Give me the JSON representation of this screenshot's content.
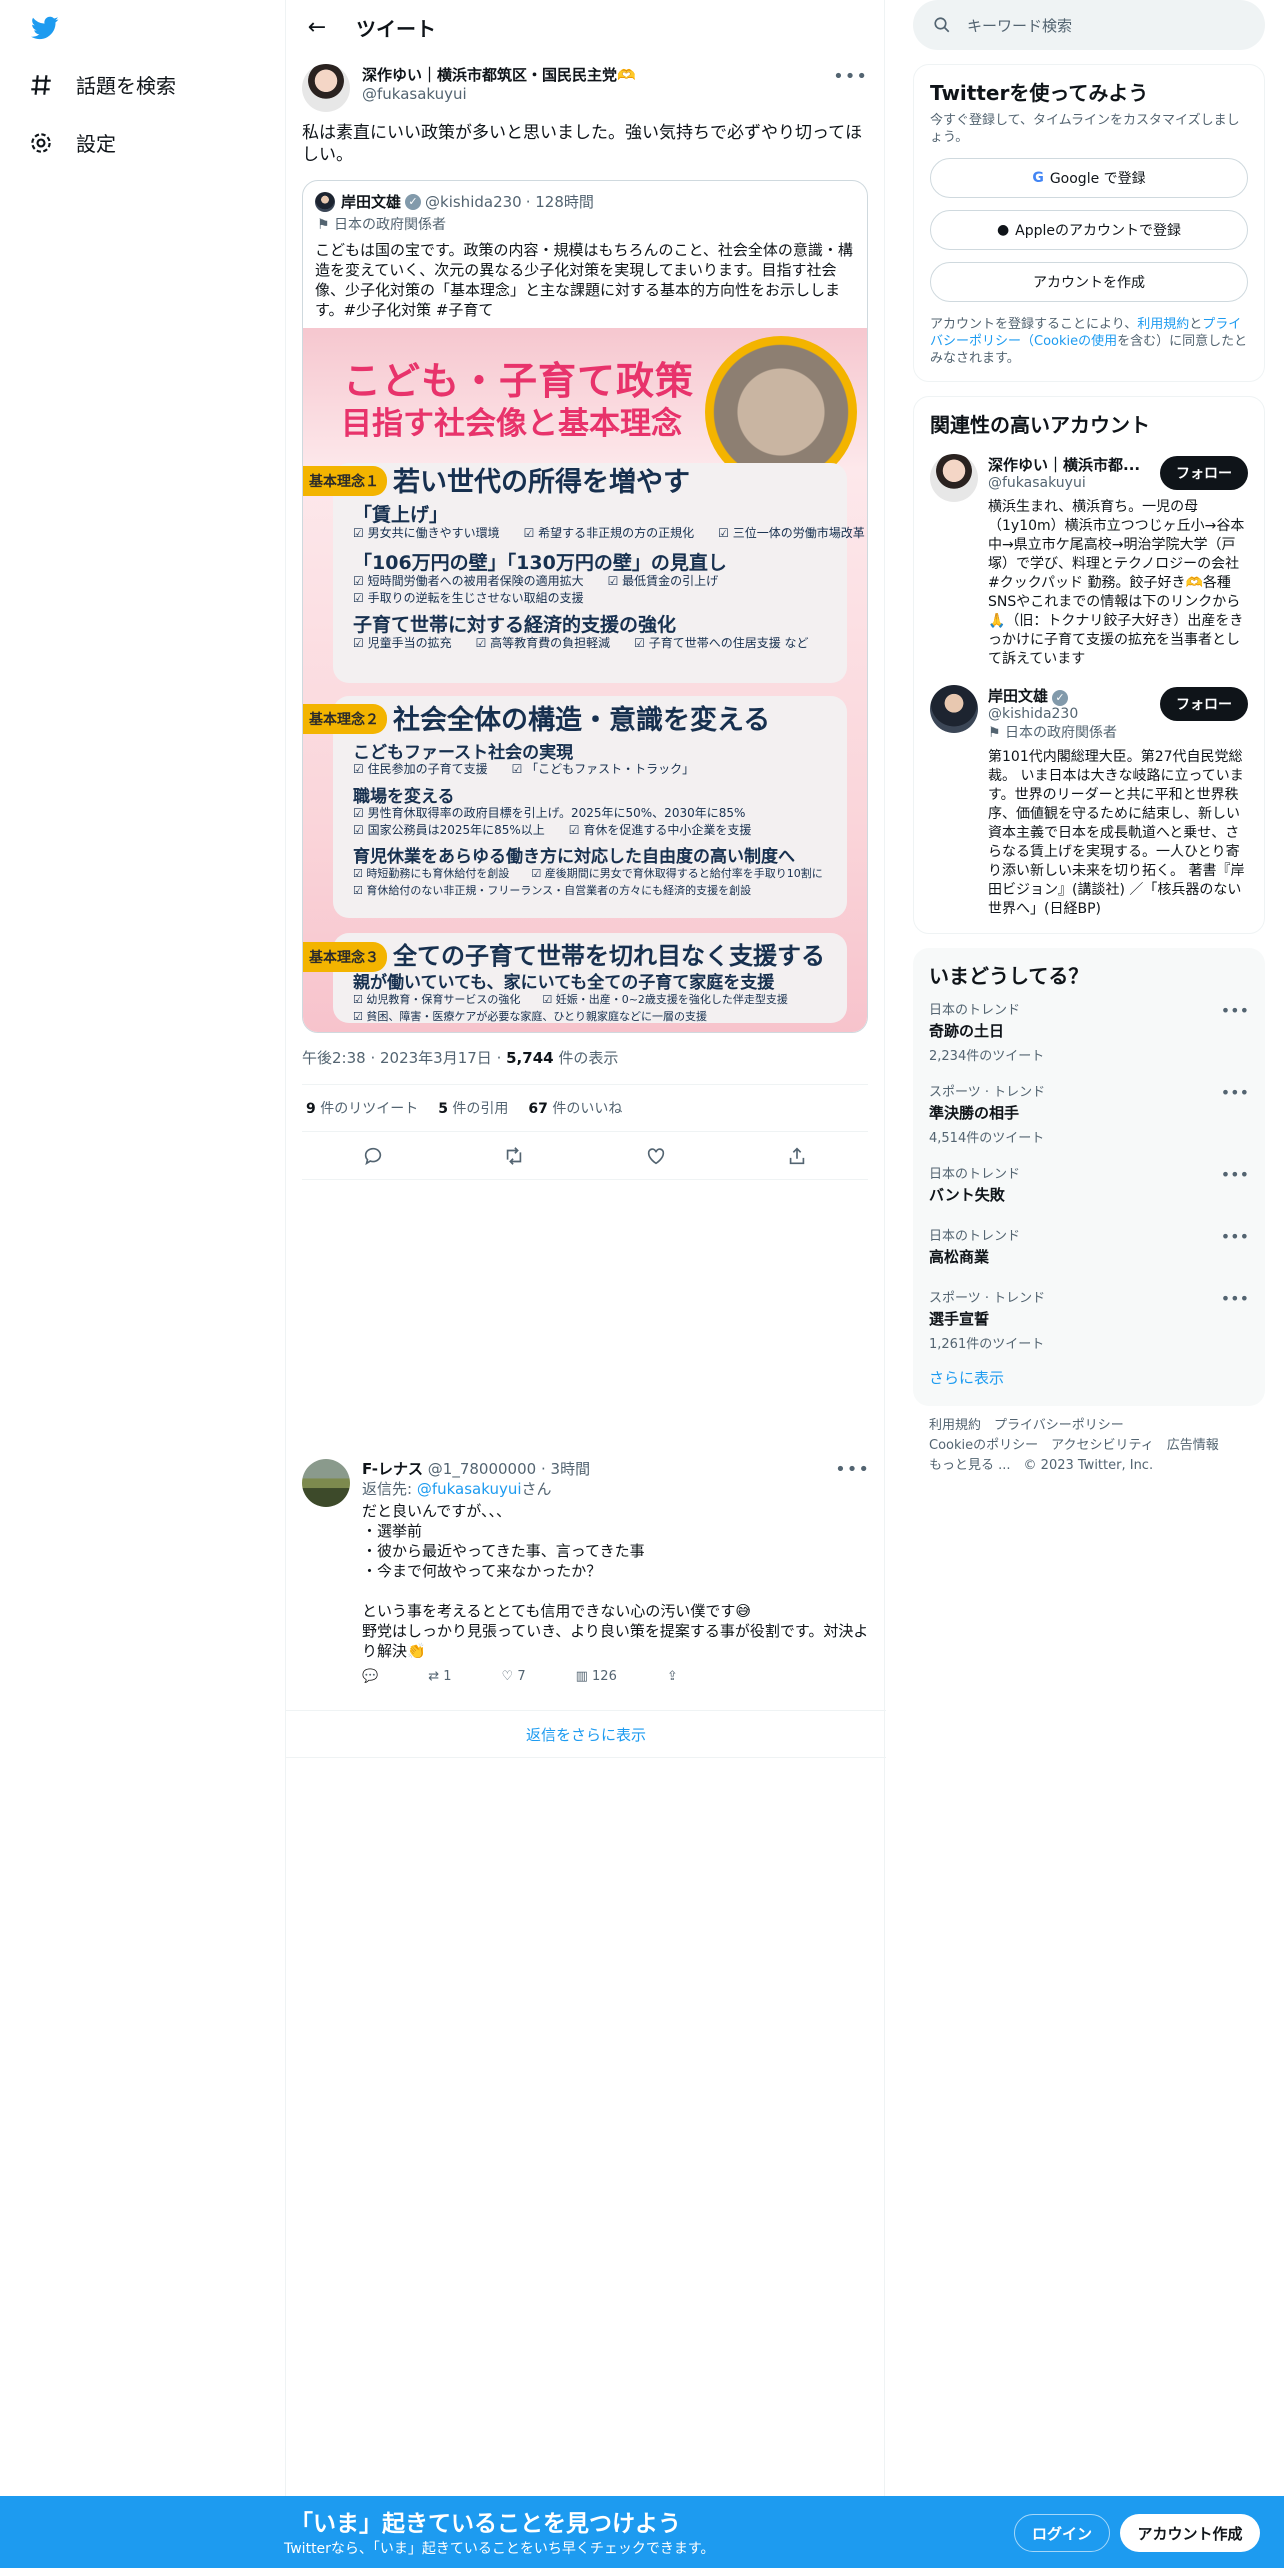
{
  "left_nav": {
    "items": [
      {
        "label": "話題を検索",
        "icon": "hashtag-icon"
      },
      {
        "label": "設定",
        "icon": "gear-icon"
      }
    ]
  },
  "header": {
    "title": "ツイート"
  },
  "main_tweet": {
    "name": "深作ゆい｜横浜市都筑区・国民民主党🫶",
    "handle": "@fukasakuyui",
    "text": "私は素直にいい政策が多いと思いました。強い気持ちで必ずやり切ってほしい。",
    "quote": {
      "name": "岸田文雄",
      "handle": "@kishida230",
      "time": "· 128時間",
      "label": "日本の政府関係者",
      "text": "こどもは国の宝です。政策の内容・規模はもちろんのこと、社会全体の意識・構造を変えていく、次元の異なる少子化対策を実現してまいります。目指す社会像、少子化対策の「基本理念」と主な課題に対する基本的方向性をお示しします。#少子化対策 #子育て",
      "poster": {
        "title": "こども・子育て政策",
        "subtitle": "目指す社会像と基本理念",
        "badge1": "基本理念１",
        "head1": "若い世代の所得を増やす",
        "s1a": "「賃上げ」",
        "s1a_items": "☑ 男女共に働きやすい環境　　☑ 希望する非正規の方の正規化　　☑ 三位一体の労働市場改革",
        "s1b": "「106万円の壁」「130万円の壁」の見直し",
        "s1b_items": "☑ 短時間労働者への被用者保険の適用拡大　　☑ 最低賃金の引上げ\n☑ 手取りの逆転を生じさせない取組の支援",
        "s1c": "子育て世帯に対する経済的支援の強化",
        "s1c_items": "☑ 児童手当の拡充　　☑ 高等教育費の負担軽減　　☑ 子育て世帯への住居支援 など",
        "badge2": "基本理念２",
        "head2": "社会全体の構造・意識を変える",
        "s2a": "こどもファースト社会の実現",
        "s2a_items": "☑ 住民参加の子育て支援　　☑ 「こどもファスト・トラック」",
        "s2b": "職場を変える",
        "s2b_items": "☑ 男性育休取得率の政府目標を引上げ。2025年に50%、2030年に85%\n☑ 国家公務員は2025年に85%以上　　☑ 育休を促進する中小企業を支援",
        "s2c": "育児休業をあらゆる働き方に対応した自由度の高い制度へ",
        "s2c_items": "☑ 時短勤務にも育休給付を創設　　☑ 産後期間に男女で育休取得すると給付率を手取り10割に\n☑ 育休給付のない非正規・フリーランス・自営業者の方々にも経済的支援を創設",
        "badge3": "基本理念３",
        "head3": "全ての子育て世帯を切れ目なく支援する",
        "s3a": "親が働いていても、家にいても全ての子育て家庭を支援",
        "s3a_items": "☑ 幼児教育・保育サービスの強化　　☑ 妊娠・出産・0~2歳支援を強化した伴走型支援\n☑ 貧困、障害・医療ケアが必要な家庭、ひとり親家庭などに一層の支援"
      }
    },
    "time": "午後2:38",
    "date": "2023年3月17日",
    "views": "5,744",
    "views_label": "件の表示",
    "retweets": "9",
    "retweets_label": "件のリツイート",
    "quotes": "5",
    "quotes_label": "件の引用",
    "likes": "67",
    "likes_label": "件のいいね"
  },
  "reply": {
    "name": "F-レナス",
    "handle": "@1_78000000",
    "time": "· 3時間",
    "reply_to_prefix": "返信先: ",
    "reply_to": "@fukasakuyui",
    "reply_to_suffix": "さん",
    "text": "だと良いんですが、、、\n・選挙前\n・彼から最近やってきた事、言ってきた事\n・今まで何故やって来なかったか？\n\nという事を考えるととても信用できない心の汚い僕です😅\n野党はしっかり見張っていき、より良い策を提案する事が役割です。対決より解決👏",
    "retweets": "1",
    "likes": "7",
    "views": "126"
  },
  "show_more_replies": "返信をさらに表示",
  "search": {
    "placeholder": "キーワード検索"
  },
  "signup_card": {
    "title": "Twitterを使ってみよう",
    "subtitle": "今すぐ登録して、タイムラインをカスタマイズしましょう。",
    "google": "Google で登録",
    "apple": "Appleのアカウントで登録",
    "create": "アカウントを作成",
    "legal_1": "アカウントを登録することにより、",
    "legal_terms": "利用規約",
    "legal_2": "と",
    "legal_privacy": "プライバシーポリシー（Cookieの使用",
    "legal_3": "を含む）に同意したとみなされます。"
  },
  "related": {
    "title": "関連性の高いアカウント",
    "accounts": [
      {
        "name": "深作ゆい｜横浜市都...",
        "handle": "@fukasakuyui",
        "follow": "フォロー",
        "bio": "横浜生まれ、横浜育ち。一児の母（1y10m）横浜市立つつじヶ丘小→谷本中→県立市ケ尾高校→明治学院大学（戸塚）で学び、料理とテクノロジーの会社 #クックパッド 勤務。餃子好き🫶各種SNSやこれまでの情報は下のリンクから🙏（旧：トクナリ餃子大好き）出産をきっかけに子育て支援の拡充を当事者として訴えています"
      },
      {
        "name": "岸田文雄",
        "handle": "@kishida230",
        "follow": "フォロー",
        "label": "日本の政府関係者",
        "bio": "第101代内閣総理大臣。第27代自民党総裁。 いま日本は大きな岐路に立っています。世界のリーダーと共に平和と世界秩序、価値観を守るために結束し、新しい資本主義で日本を成長軌道へと乗せ、さらなる賃上げを実現する。一人ひとり寄り添い新しい未来を切り拓く。 著書『岸田ビジョン』(講談社) ／「核兵器のない世界へ」(日経BP)"
      }
    ]
  },
  "trends": {
    "title": "いまどうしてる？",
    "items": [
      {
        "context": "日本のトレンド",
        "name": "奇跡の土日",
        "count": "2,234件のツイート"
      },
      {
        "context": "スポーツ · トレンド",
        "name": "準決勝の相手",
        "count": "4,514件のツイート"
      },
      {
        "context": "日本のトレンド",
        "name": "バント失敗",
        "count": ""
      },
      {
        "context": "日本のトレンド",
        "name": "高松商業",
        "count": ""
      },
      {
        "context": "スポーツ · トレンド",
        "name": "選手宣誓",
        "count": "1,261件のツイート"
      }
    ],
    "show_more": "さらに表示"
  },
  "footer": {
    "links": [
      "利用規約",
      "プライバシーポリシー",
      "Cookieのポリシー",
      "アクセシビリティ",
      "広告情報",
      "もっと見る ..."
    ],
    "copyright": "© 2023 Twitter, Inc."
  },
  "banner": {
    "title": "「いま」起きていることを見つけよう",
    "subtitle": "Twitterなら、「いま」起きていることをいち早くチェックできます。",
    "login": "ログイン",
    "signup": "アカウント作成"
  },
  "colors": {
    "brand": "#1d9bf0",
    "text": "#0f1419",
    "secondary": "#536471",
    "poster_pink": "#e8336b",
    "poster_gold": "#f3b400"
  }
}
